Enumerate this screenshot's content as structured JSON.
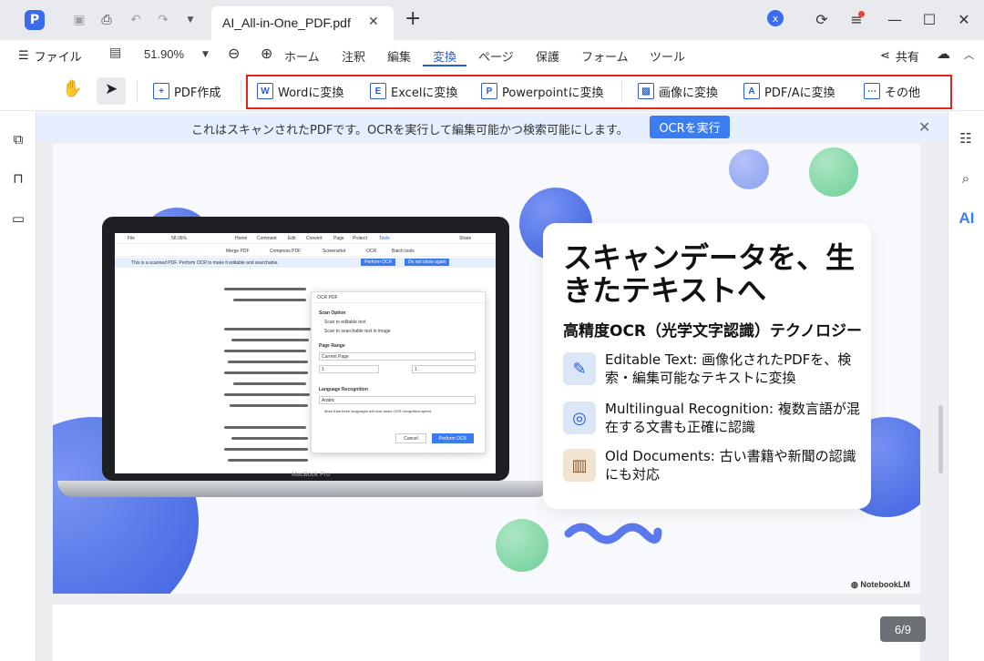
{
  "window": {
    "tab_title": "AI_All-in-One_PDF.pdf",
    "tab_close": "✕",
    "new_tab": "+",
    "account_initial": "x"
  },
  "menu": {
    "file": "ファイル",
    "zoom": "51.90%",
    "items": [
      "ホーム",
      "注釈",
      "編集",
      "変換",
      "ページ",
      "保護",
      "フォーム",
      "ツール"
    ],
    "active": "変換",
    "share": "共有"
  },
  "toolbar": {
    "create_pdf": "PDF作成",
    "word": "Wordに変換",
    "excel": "Excelに変換",
    "powerpoint": "Powerpointに変換",
    "image": "画像に変換",
    "pdfa": "PDF/Aに変換",
    "other": "その他",
    "highlight_color": "#e2231a",
    "accent_color": "#2a5bd7"
  },
  "ocr_banner": {
    "message": "これはスキャンされたPDFです。OCRを実行して編集可能かつ検索可能にします。",
    "button": "OCRを実行"
  },
  "right_rail": {
    "ai_label": "AI"
  },
  "slide": {
    "title": "スキャンデータを、生きたテキストへ",
    "subtitle": "高精度OCR（光学文字認識）テクノロジー",
    "features": [
      {
        "icon": "edit-document-icon",
        "text": "Editable Text: 画像化されたPDFを、検索・編集可能なテキストに変換"
      },
      {
        "icon": "translate-globe-icon",
        "text": "Multilingual Recognition: 複数言語が混在する文書も正確に認識"
      },
      {
        "icon": "book-icon",
        "text": "Old Documents: 古い書籍や新聞の認識にも対応"
      }
    ],
    "brand": "NotebookLM",
    "laptop_brand": "MacBook Pro",
    "mini_app": {
      "menu": [
        "File",
        "58.06%",
        "Home",
        "Comment",
        "Edit",
        "Convert",
        "Page",
        "Protect",
        "Tools",
        "Share"
      ],
      "tools": [
        "Merge PDF",
        "Compress PDF",
        "Screenshot",
        "OCR",
        "Batch tools"
      ],
      "banner": "This is a scanned PDF. Perform OCR to make it editable and searchable.",
      "banner_btn1": "Perform OCR",
      "banner_btn2": "Do not show again",
      "dialog": {
        "title": "OCR PDF",
        "scan_option": "Scan Option",
        "opt1": "Scan to editable text",
        "opt2": "Scan to searchable text in image",
        "page_range": "Page Range",
        "page_value": "Current Page",
        "from": "1",
        "to": "1",
        "lang_label": "Language Recognition",
        "lang_value": "Arabic",
        "note": "More than three languages will slow down OCR recognition speed.",
        "cancel": "Cancel",
        "perform": "Perform OCR"
      }
    }
  },
  "page_counter": "6/9"
}
